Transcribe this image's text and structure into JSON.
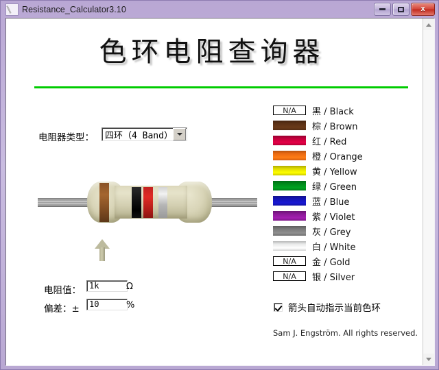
{
  "window": {
    "title": "Resistance_Calculator3.10",
    "icon": "pencil-icon",
    "controls": {
      "minimize": "–",
      "maximize": "□",
      "close": "x"
    }
  },
  "heading": "色环电阻查询器",
  "type_selector": {
    "label": "电阻器类型：",
    "value": "四环（4 Band）"
  },
  "resistor": {
    "bands": [
      {
        "name": "band-1",
        "color_name": "Brown",
        "hex": "#8a5326"
      },
      {
        "name": "band-2",
        "color_name": "Black",
        "hex": "#141414"
      },
      {
        "name": "band-3",
        "color_name": "Red",
        "hex": "#c32220"
      },
      {
        "name": "band-4",
        "color_name": "Silver",
        "hex": "#c8c8c8"
      }
    ],
    "arrow_points_to": "band-1"
  },
  "values": {
    "resistance_label": "电阻值：",
    "resistance_value": "1k",
    "resistance_unit": "Ω",
    "tolerance_label": "偏差：±",
    "tolerance_value": "10",
    "tolerance_unit": "%"
  },
  "legend": [
    {
      "zh": "黑",
      "en": "Black",
      "hex": "#241c1c",
      "na": true,
      "na_text": "N/A"
    },
    {
      "zh": "棕",
      "en": "Brown",
      "hex": "#5b3115",
      "na": false,
      "na_text": ""
    },
    {
      "zh": "红",
      "en": "Red",
      "hex": "#c2003c",
      "na": false,
      "na_text": ""
    },
    {
      "zh": "橙",
      "en": "Orange",
      "hex": "#ea6a12",
      "na": false,
      "na_text": ""
    },
    {
      "zh": "黄",
      "en": "Yellow",
      "hex": "#e0dc00",
      "na": false,
      "na_text": ""
    },
    {
      "zh": "绿",
      "en": "Green",
      "hex": "#00891b",
      "na": false,
      "na_text": ""
    },
    {
      "zh": "蓝",
      "en": "Blue",
      "hex": "#1414b4",
      "na": false,
      "na_text": ""
    },
    {
      "zh": "紫",
      "en": "Violet",
      "hex": "#8a1a96",
      "na": false,
      "na_text": ""
    },
    {
      "zh": "灰",
      "en": "Grey",
      "hex": "#7a7a7a",
      "na": false,
      "na_text": ""
    },
    {
      "zh": "白",
      "en": "White",
      "hex": "#e9eaea",
      "na": false,
      "na_text": ""
    },
    {
      "zh": "金",
      "en": "Gold",
      "hex": "#ffffff",
      "na": true,
      "na_text": "N/A"
    },
    {
      "zh": "银",
      "en": "Silver",
      "hex": "#ffffff",
      "na": true,
      "na_text": "N/A"
    }
  ],
  "checkbox": {
    "label": "箭头自动指示当前色环",
    "checked": true
  },
  "footer": "Sam J. Engström. All rights reserved.",
  "colors": {
    "titlebar": "#b9a7d4",
    "rule_green": "#00cc00",
    "close_red": "#d4463a"
  }
}
